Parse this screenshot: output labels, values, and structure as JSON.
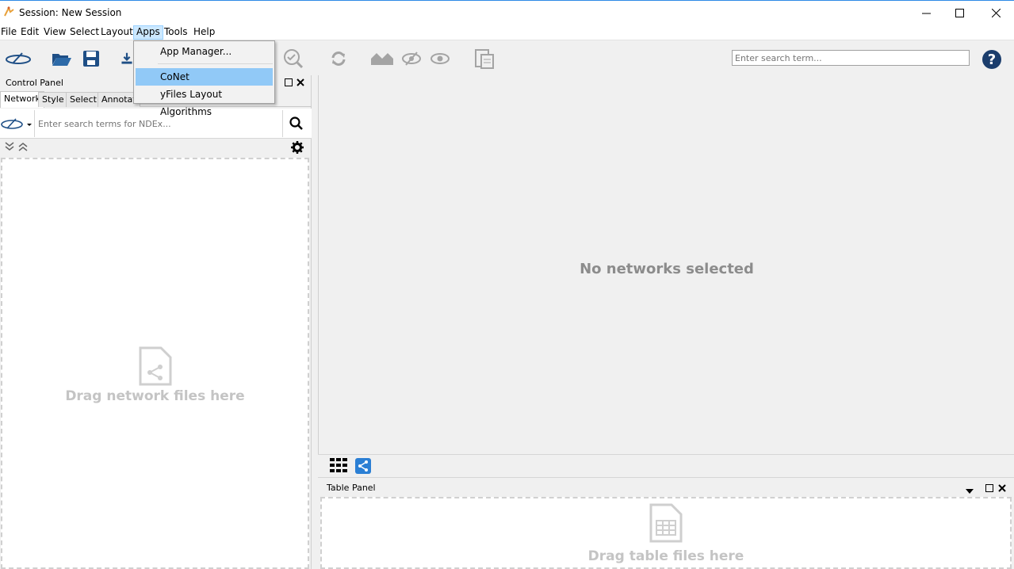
{
  "window": {
    "title": "Session: New Session",
    "controls": [
      "minimize-icon",
      "maximize-icon",
      "close-icon"
    ]
  },
  "menubar": {
    "items": [
      {
        "label": "File"
      },
      {
        "label": "Edit"
      },
      {
        "label": "View"
      },
      {
        "label": "Select"
      },
      {
        "label": "Layout"
      },
      {
        "label": "Apps",
        "active": true
      },
      {
        "label": "Tools"
      },
      {
        "label": "Help"
      }
    ]
  },
  "apps_menu": {
    "items": [
      {
        "label": "App Manager..."
      },
      {
        "label": "CoNet",
        "highlighted": true
      },
      {
        "label": "yFiles Layout Algorithms"
      }
    ]
  },
  "toolbar": {
    "icons": [
      "ndex-icon",
      "open-folder-icon",
      "save-icon",
      "import-icon",
      "zoom-selected-icon",
      "refresh-icon",
      "home-icon",
      "hide-icon",
      "show-icon",
      "document-icon"
    ],
    "search_placeholder": "Enter search term...",
    "help_label": "?"
  },
  "control_panel": {
    "title": "Control Panel",
    "tabs": [
      {
        "label": "Network",
        "active": true
      },
      {
        "label": "Style"
      },
      {
        "label": "Select"
      },
      {
        "label": "Annotat"
      }
    ],
    "ndex_search_placeholder": "Enter search terms for NDEx...",
    "drop_text": "Drag network files here"
  },
  "network_view": {
    "empty_text": "No networks selected"
  },
  "table_panel": {
    "title": "Table Panel",
    "drop_text": "Drag table files here"
  },
  "colors": {
    "accent": "#2e8ae6",
    "menu_highlight": "#91c9f7",
    "help_icon": "#1b3d6c",
    "toolbar_icon": "#1f4f86"
  }
}
